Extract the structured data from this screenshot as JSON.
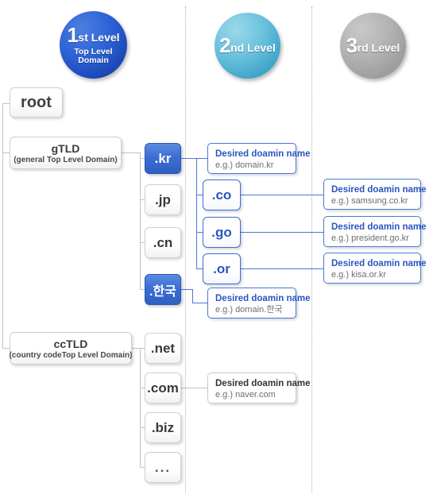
{
  "diagram": {
    "title": "Domain name hierarchy",
    "colors": {
      "level1_circle": "#2e62d6",
      "level2_circle": "#6dc3de",
      "level3_circle": "#b3b3b3",
      "selected_box": "#3a6ed4",
      "accent_text": "#2a55c0",
      "line_gray": "#c2c2c2",
      "line_blue": "#4a78d8"
    },
    "levels": [
      {
        "num": "1",
        "ordinal": "st",
        "word": "Level",
        "sub": "Top Level\nDomain",
        "sub_line1": "Top Level",
        "sub_line2": "Domain"
      },
      {
        "num": "2",
        "ordinal": "nd",
        "word": "Level",
        "sub_line1": "",
        "sub_line2": ""
      },
      {
        "num": "3",
        "ordinal": "rd",
        "word": "Level",
        "sub_line1": "",
        "sub_line2": ""
      }
    ],
    "root": {
      "label": "root"
    },
    "groups": [
      {
        "label": "gTLD",
        "sub": "(general Top Level Domain)"
      },
      {
        "label": "ccTLD",
        "sub": "(country codeTop Level Domain)"
      }
    ],
    "tlds": [
      {
        "label": ".kr",
        "selected": true
      },
      {
        "label": ".jp",
        "selected": false
      },
      {
        "label": ".cn",
        "selected": false
      },
      {
        "label": ".한국",
        "selected": true
      },
      {
        "label": ".net",
        "selected": false
      },
      {
        "label": ".com",
        "selected": false
      },
      {
        "label": ".biz",
        "selected": false
      },
      {
        "label": "...",
        "selected": false
      }
    ],
    "second_level": [
      {
        "label": ".co"
      },
      {
        "label": ".go"
      },
      {
        "label": ".or"
      }
    ],
    "info_boxes": [
      {
        "id": "kr",
        "title": "Desired doamin name",
        "example": "e.g.) domain.kr",
        "style": "blue"
      },
      {
        "id": "co",
        "title": "Desired doamin name",
        "example": "e.g.) samsung.co.kr",
        "style": "blue"
      },
      {
        "id": "go",
        "title": "Desired doamin name",
        "example": "e.g.) president.go.kr",
        "style": "blue"
      },
      {
        "id": "or",
        "title": "Desired doamin name",
        "example": "e.g.) kisa.or.kr",
        "style": "blue"
      },
      {
        "id": "hanguk",
        "title": "Desired doamin name",
        "example": "e.g.) domain.한국",
        "style": "blue"
      },
      {
        "id": "com",
        "title": "Desired doamin name",
        "example": "e.g.) naver.com",
        "style": "gray"
      }
    ]
  }
}
